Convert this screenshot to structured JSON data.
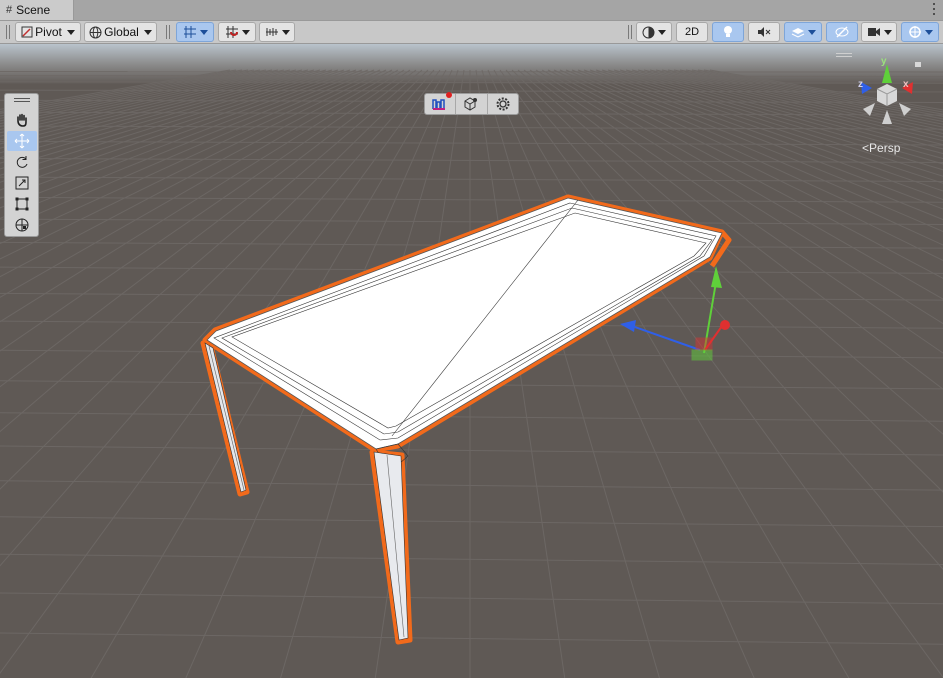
{
  "tab": {
    "label": "Scene",
    "icon": "hash-icon"
  },
  "toolbar": {
    "pivot_label": "Pivot",
    "global_label": "Global",
    "twod_label": "2D"
  },
  "tools": [
    "hand",
    "move",
    "rotate",
    "scale",
    "rect",
    "transform"
  ],
  "active_tool": "move",
  "gizmo": {
    "y_label": "y",
    "x_label": "x",
    "z_label": "z",
    "view_label": "Persp"
  },
  "colors": {
    "selection_outline": "#f26a1b",
    "background": "#5f5955",
    "toolbar_active": "#a9c7ef",
    "axis_x": "#e03030",
    "axis_y": "#5fd03a",
    "axis_z": "#2f5fe8"
  }
}
